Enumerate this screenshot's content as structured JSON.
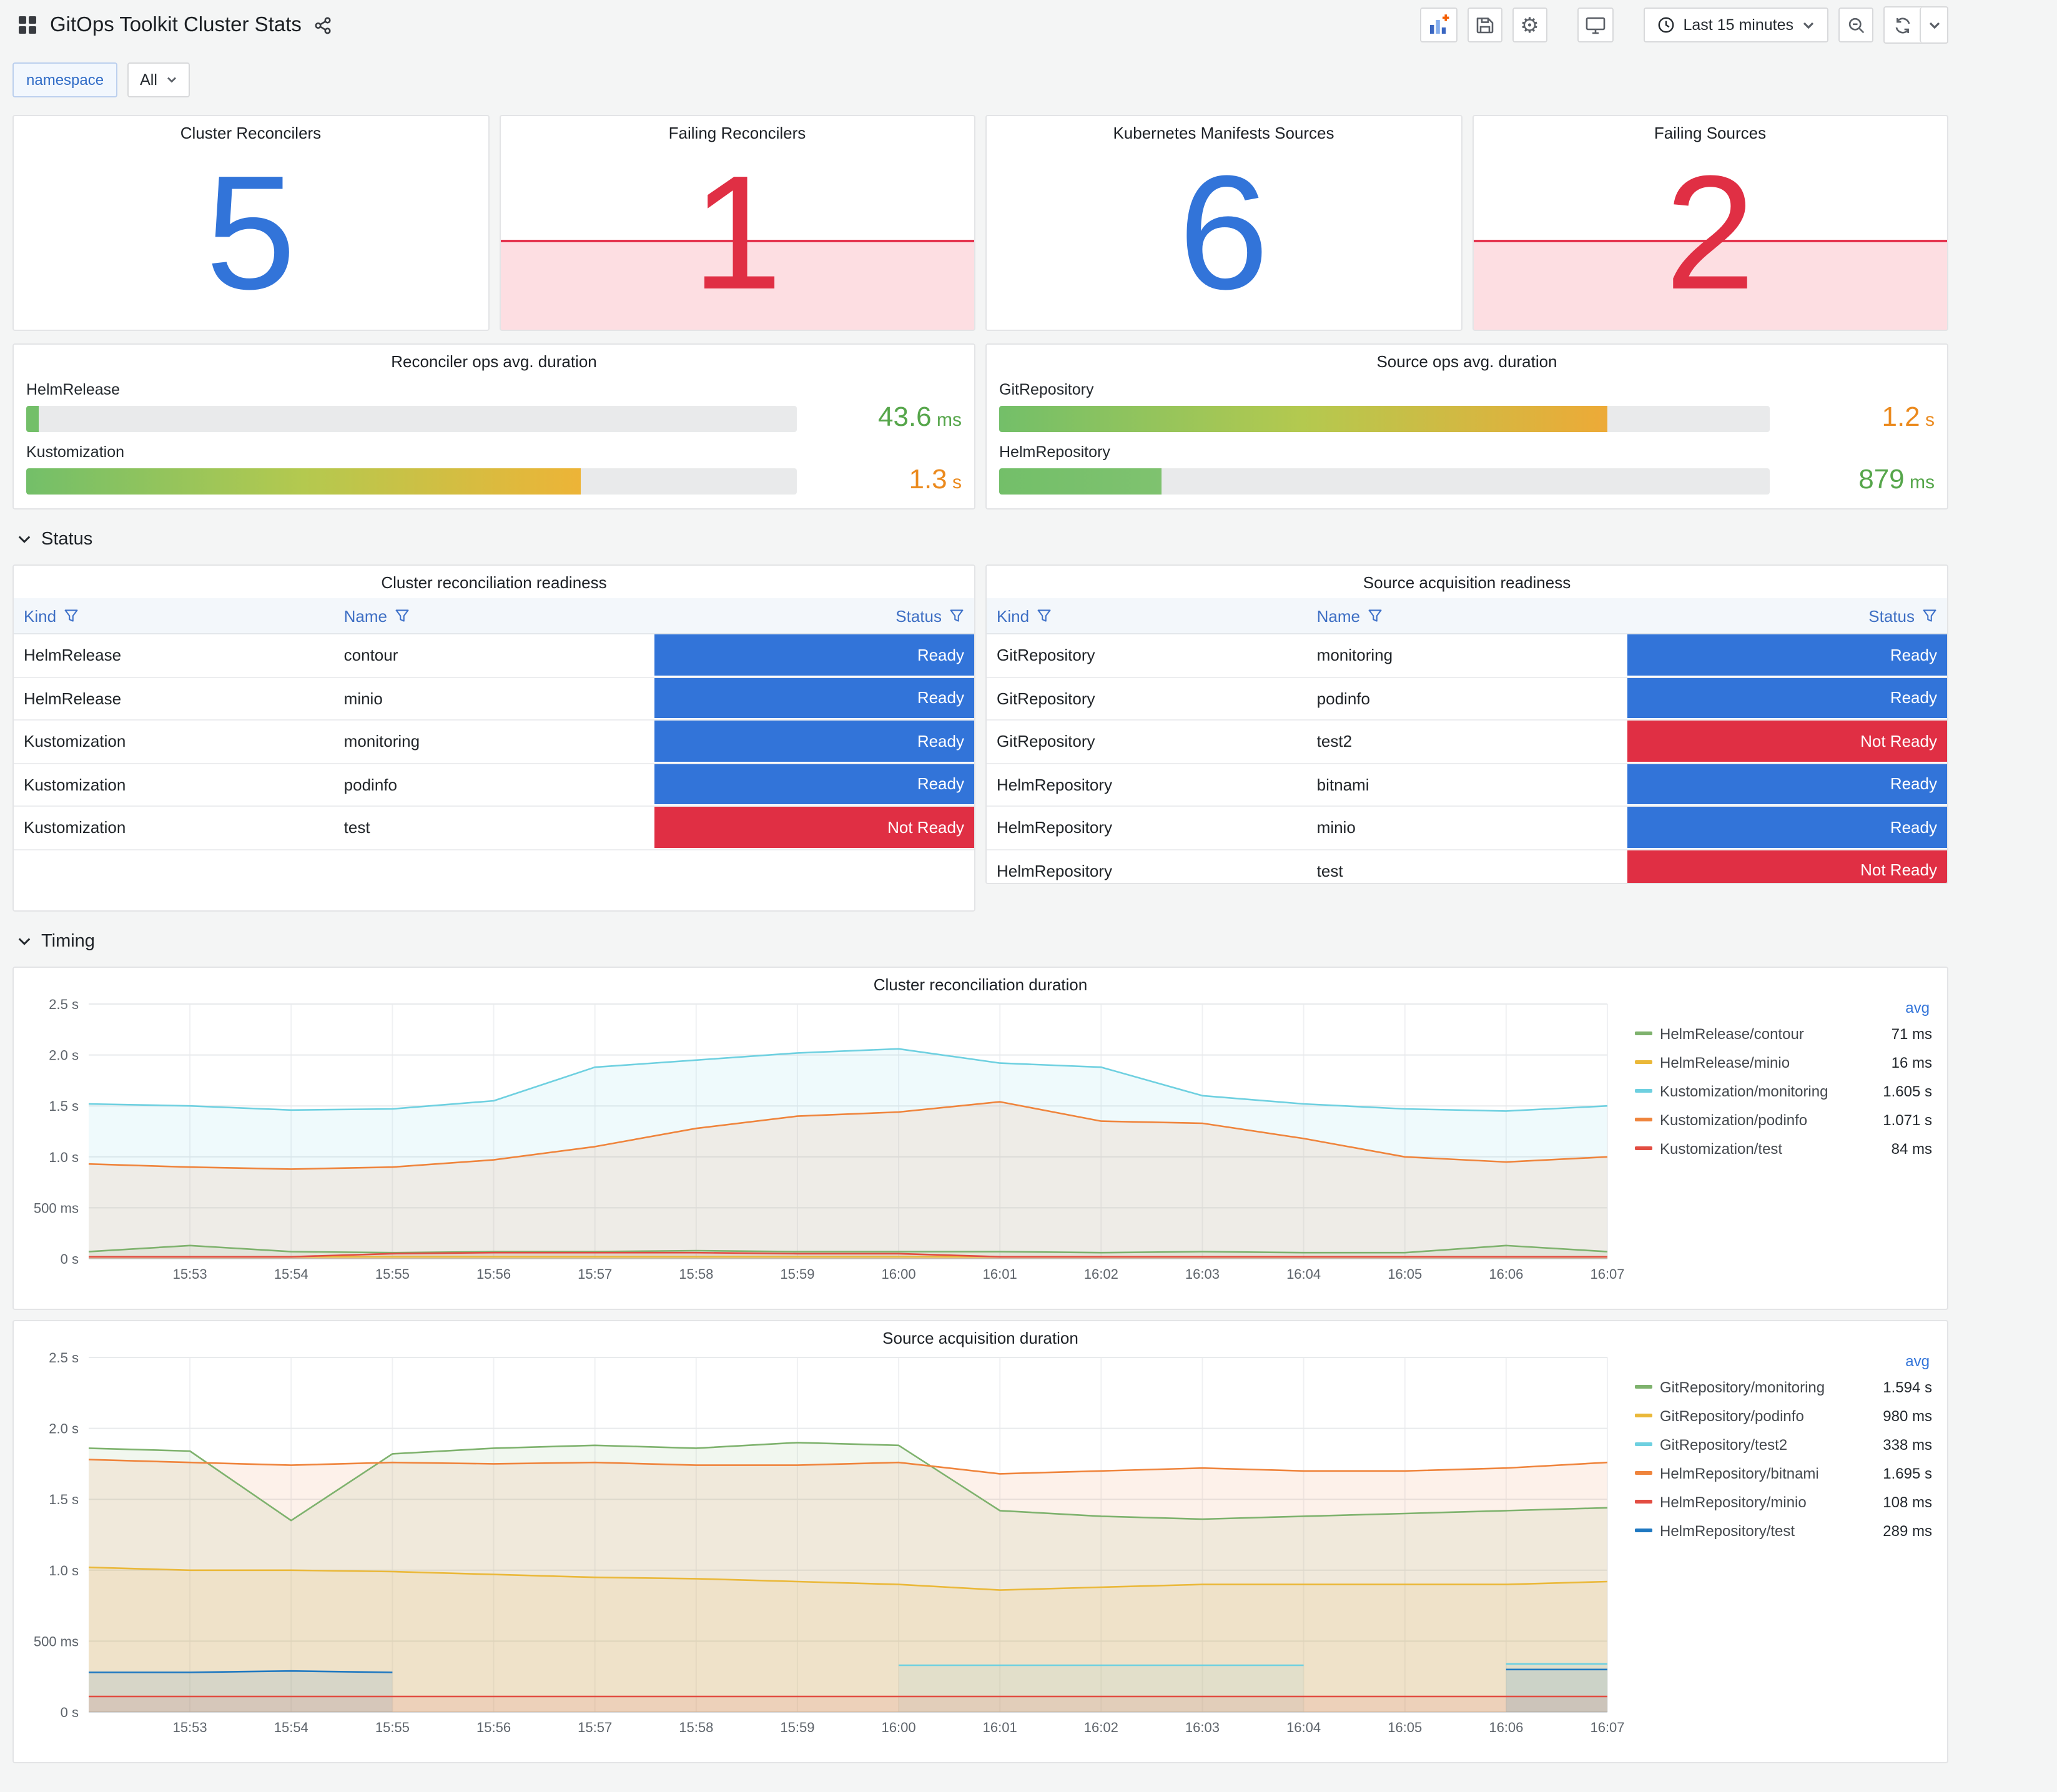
{
  "header": {
    "title": "GitOps Toolkit Cluster Stats",
    "time_range": "Last 15 minutes"
  },
  "icons": {
    "dashboard-grid-icon": "four-squares",
    "share-icon": "share-nodes",
    "add-panel-icon": "chart-with-plus",
    "save-icon": "floppy-disk",
    "settings-icon": "gear",
    "tv-icon": "monitor",
    "clock-icon": "clock",
    "zoom-out-icon": "magnifier-minus",
    "refresh-icon": "circular-arrows",
    "caret-icon": "chevron-down",
    "filter-icon": "funnel",
    "collapse-icon": "chevron-down"
  },
  "variables": {
    "label": "namespace",
    "value": "All"
  },
  "sections": {
    "status": "Status",
    "timing": "Timing"
  },
  "stat_panels": [
    {
      "title": "Cluster Reconcilers",
      "value": "5",
      "color": "#3274D9",
      "alert": false
    },
    {
      "title": "Failing Reconcilers",
      "value": "1",
      "color": "#E02F44",
      "alert": true
    },
    {
      "title": "Kubernetes Manifests Sources",
      "value": "6",
      "color": "#3274D9",
      "alert": false
    },
    {
      "title": "Failing Sources",
      "value": "2",
      "color": "#E02F44",
      "alert": true
    }
  ],
  "duration_gauges": [
    {
      "title": "Reconciler ops avg. duration",
      "rows": [
        {
          "label": "HelmRelease",
          "value": "43.6",
          "unit": "ms",
          "pct": 1.6,
          "value_color": "#56A64B",
          "bar_colors": [
            "#73BF69",
            "#73BF69"
          ]
        },
        {
          "label": "Kustomization",
          "value": "1.3",
          "unit": "s",
          "pct": 72,
          "value_color": "#EB8A1E",
          "bar_colors": [
            "#73BF69",
            "#B4C94F",
            "#EDB437"
          ]
        }
      ]
    },
    {
      "title": "Source ops avg. duration",
      "rows": [
        {
          "label": "GitRepository",
          "value": "1.2",
          "unit": "s",
          "pct": 79,
          "value_color": "#EB8A1E",
          "bar_colors": [
            "#73BF69",
            "#B4C94F",
            "#EDAA37"
          ]
        },
        {
          "label": "HelmRepository",
          "value": "879",
          "unit": "ms",
          "pct": 21,
          "value_color": "#56A64B",
          "bar_colors": [
            "#73BF69",
            "#7FC26F"
          ]
        }
      ]
    }
  ],
  "status_colors": {
    "Ready": "#3274D9",
    "Not Ready": "#E02F44"
  },
  "status_tables": [
    {
      "title": "Cluster reconciliation readiness",
      "columns": [
        "Kind",
        "Name",
        "Status"
      ],
      "rows": [
        {
          "kind": "HelmRelease",
          "name": "contour",
          "status": "Ready"
        },
        {
          "kind": "HelmRelease",
          "name": "minio",
          "status": "Ready"
        },
        {
          "kind": "Kustomization",
          "name": "monitoring",
          "status": "Ready"
        },
        {
          "kind": "Kustomization",
          "name": "podinfo",
          "status": "Ready"
        },
        {
          "kind": "Kustomization",
          "name": "test",
          "status": "Not Ready"
        }
      ]
    },
    {
      "title": "Source acquisition readiness",
      "columns": [
        "Kind",
        "Name",
        "Status"
      ],
      "rows": [
        {
          "kind": "GitRepository",
          "name": "monitoring",
          "status": "Ready"
        },
        {
          "kind": "GitRepository",
          "name": "podinfo",
          "status": "Ready"
        },
        {
          "kind": "GitRepository",
          "name": "test2",
          "status": "Not Ready"
        },
        {
          "kind": "HelmRepository",
          "name": "bitnami",
          "status": "Ready"
        },
        {
          "kind": "HelmRepository",
          "name": "minio",
          "status": "Ready"
        },
        {
          "kind": "HelmRepository",
          "name": "test",
          "status": "Not Ready"
        }
      ]
    }
  ],
  "chart_data": [
    {
      "type": "line",
      "title": "Cluster reconciliation duration",
      "legend_header": "avg",
      "legend_position": "right",
      "grid": true,
      "y_max": 2.5,
      "y_ticks": [
        "0 s",
        "500 ms",
        "1.0 s",
        "1.5 s",
        "2.0 s",
        "2.5 s"
      ],
      "x_ticks": [
        "15:53",
        "15:54",
        "15:55",
        "15:56",
        "15:57",
        "15:58",
        "15:59",
        "16:00",
        "16:01",
        "16:02",
        "16:03",
        "16:04",
        "16:05",
        "16:06",
        "16:07"
      ],
      "series": [
        {
          "name": "HelmRelease/contour",
          "avg": "71 ms",
          "color": "#7EB26D",
          "values": [
            0.07,
            0.13,
            0.07,
            0.06,
            0.07,
            0.07,
            0.08,
            0.07,
            0.07,
            0.07,
            0.06,
            0.07,
            0.06,
            0.06,
            0.13,
            0.07
          ]
        },
        {
          "name": "HelmRelease/minio",
          "avg": "16 ms",
          "color": "#EAB839",
          "values": [
            0.02,
            0.02,
            0.02,
            0.02,
            0.02,
            0.02,
            0.02,
            0.02,
            0.02,
            0.02,
            0.02,
            0.02,
            0.02,
            0.02,
            0.02,
            0.02
          ]
        },
        {
          "name": "Kustomization/monitoring",
          "avg": "1.605 s",
          "color": "#6ED0E0",
          "values": [
            1.52,
            1.5,
            1.46,
            1.47,
            1.55,
            1.88,
            1.95,
            2.02,
            2.06,
            1.92,
            1.88,
            1.6,
            1.52,
            1.47,
            1.45,
            1.5
          ]
        },
        {
          "name": "Kustomization/podinfo",
          "avg": "1.071 s",
          "color": "#EF843C",
          "values": [
            0.93,
            0.9,
            0.88,
            0.9,
            0.97,
            1.1,
            1.28,
            1.4,
            1.44,
            1.54,
            1.35,
            1.33,
            1.18,
            1.0,
            0.95,
            1.0
          ]
        },
        {
          "name": "Kustomization/test",
          "avg": "84 ms",
          "color": "#E24D42",
          "values": [
            0.02,
            0.02,
            0.02,
            0.05,
            0.06,
            0.06,
            0.06,
            0.05,
            0.05,
            0.02,
            0.02,
            0.02,
            0.02,
            0.02,
            0.02,
            0.02
          ]
        }
      ]
    },
    {
      "type": "line",
      "title": "Source acquisition duration",
      "legend_header": "avg",
      "legend_position": "right",
      "grid": true,
      "y_max": 2.5,
      "y_ticks": [
        "0 s",
        "500 ms",
        "1.0 s",
        "1.5 s",
        "2.0 s",
        "2.5 s"
      ],
      "x_ticks": [
        "15:53",
        "15:54",
        "15:55",
        "15:56",
        "15:57",
        "15:58",
        "15:59",
        "16:00",
        "16:01",
        "16:02",
        "16:03",
        "16:04",
        "16:05",
        "16:06",
        "16:07"
      ],
      "series": [
        {
          "name": "GitRepository/monitoring",
          "avg": "1.594 s",
          "color": "#7EB26D",
          "values": [
            1.86,
            1.84,
            1.35,
            1.82,
            1.86,
            1.88,
            1.86,
            1.9,
            1.88,
            1.42,
            1.38,
            1.36,
            1.38,
            1.4,
            1.42,
            1.44
          ]
        },
        {
          "name": "GitRepository/podinfo",
          "avg": "980 ms",
          "color": "#EAB839",
          "values": [
            1.02,
            1.0,
            1.0,
            0.99,
            0.97,
            0.95,
            0.94,
            0.92,
            0.9,
            0.86,
            0.88,
            0.9,
            0.9,
            0.9,
            0.9,
            0.92
          ]
        },
        {
          "name": "GitRepository/test2",
          "avg": "338 ms",
          "color": "#6ED0E0",
          "values": [
            null,
            null,
            null,
            null,
            null,
            null,
            null,
            null,
            0.33,
            0.33,
            0.33,
            0.33,
            0.33,
            null,
            0.34,
            0.34
          ]
        },
        {
          "name": "HelmRepository/bitnami",
          "avg": "1.695 s",
          "color": "#EF843C",
          "values": [
            1.78,
            1.76,
            1.74,
            1.76,
            1.75,
            1.76,
            1.74,
            1.74,
            1.76,
            1.68,
            1.7,
            1.72,
            1.7,
            1.7,
            1.72,
            1.76
          ]
        },
        {
          "name": "HelmRepository/minio",
          "avg": "108 ms",
          "color": "#E24D42",
          "values": [
            0.11,
            0.11,
            0.11,
            0.11,
            0.11,
            0.11,
            0.11,
            0.11,
            0.11,
            0.11,
            0.11,
            0.11,
            0.11,
            0.11,
            0.11,
            0.11
          ]
        },
        {
          "name": "HelmRepository/test",
          "avg": "289 ms",
          "color": "#1F78C1",
          "values": [
            0.28,
            0.28,
            0.29,
            0.28,
            null,
            null,
            null,
            null,
            null,
            null,
            null,
            null,
            null,
            null,
            0.3,
            0.3
          ]
        }
      ]
    }
  ]
}
